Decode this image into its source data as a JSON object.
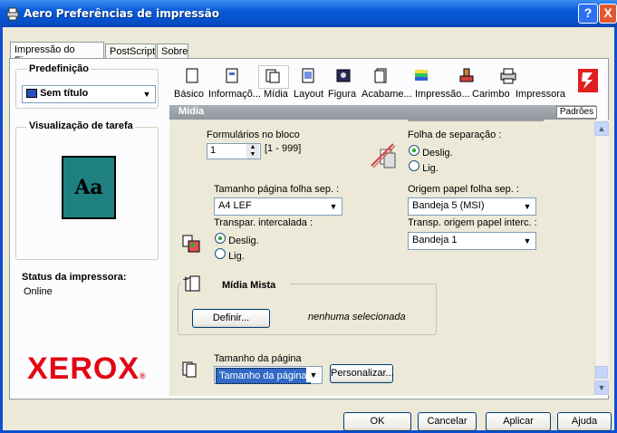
{
  "window": {
    "title": "Aero Preferências de impressão",
    "help_btn": "?",
    "close_btn": "X"
  },
  "tabs": [
    {
      "label": "Impressão do Fiery"
    },
    {
      "label": "PostScript"
    },
    {
      "label": "Sobre"
    }
  ],
  "left": {
    "preset_title": "Predefinição",
    "preset_value": "Sem título",
    "preview_title": "Visualização de tarefa",
    "preview_glyph": "Aa",
    "status_label": "Status da impressora:",
    "status_value": "Online",
    "logo": "XEROX"
  },
  "toolbar": {
    "items": [
      {
        "label": "Básico",
        "icon": "page-icon"
      },
      {
        "label": "Informaçõ...",
        "icon": "info-icon"
      },
      {
        "label": "Mídia",
        "icon": "media-icon"
      },
      {
        "label": "Layout",
        "icon": "layout-icon"
      },
      {
        "label": "Figura",
        "icon": "image-icon"
      },
      {
        "label": "Acabame...",
        "icon": "finishing-icon"
      },
      {
        "label": "Impressão...",
        "icon": "color-icon"
      },
      {
        "label": "Carimbo",
        "icon": "stamp-icon"
      },
      {
        "label": "Impressora",
        "icon": "printer-icon"
      }
    ],
    "fiery_logo": "fiery"
  },
  "section": {
    "title": "Mídia",
    "defaults_btn": "Padrões"
  },
  "media": {
    "forms_label": "Formulários no bloco",
    "forms_value": "1",
    "forms_range": "[1 - 999]",
    "sep_sheet_label": "Folha de separação :",
    "sep_off": "Deslig.",
    "sep_on": "Lig.",
    "sep_size_label": "Tamanho página folha sep. :",
    "sep_size_value": "A4 LEF",
    "sep_source_label": "Origem papel folha sep. :",
    "sep_source_value": "Bandeja 5 (MSI)",
    "trans_label": "Transpar. intercalada :",
    "trans_off": "Deslig.",
    "trans_on": "Lig.",
    "trans_source_label": "Transp. origem papel interc. :",
    "trans_source_value": "Bandeja 1",
    "mixed_title": "Mídia Mista",
    "define_btn": "Definir...",
    "mixed_status": "nenhuma selecionada",
    "page_size_label": "Tamanho da página",
    "page_size_value": "Tamanho da página",
    "customize_btn": "Personalizar..."
  },
  "footer": {
    "ok": "OK",
    "cancel": "Cancelar",
    "apply": "Aplicar",
    "help": "Ajuda"
  }
}
